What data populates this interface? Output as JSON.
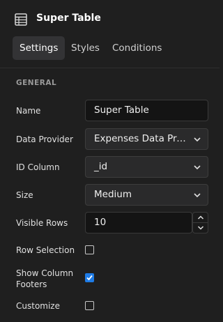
{
  "header": {
    "title": "Super Table",
    "icon": "table-icon"
  },
  "tabs": [
    {
      "label": "Settings",
      "active": true
    },
    {
      "label": "Styles",
      "active": false
    },
    {
      "label": "Conditions",
      "active": false
    }
  ],
  "section": {
    "label": "GENERAL"
  },
  "fields": {
    "name": {
      "label": "Name",
      "value": "Super Table"
    },
    "data_provider": {
      "label": "Data Provider",
      "value": "Expenses Data Provi..."
    },
    "id_column": {
      "label": "ID Column",
      "value": "_id"
    },
    "size": {
      "label": "Size",
      "value": "Medium"
    },
    "visible_rows": {
      "label": "Visible Rows",
      "value": "10"
    },
    "row_selection": {
      "label": "Row Selection",
      "checked": false
    },
    "show_column_footers": {
      "label_line1": "Show Column",
      "label_line2": "Footers",
      "checked": true
    },
    "customize": {
      "label": "Customize",
      "checked": false
    }
  },
  "colors": {
    "accent": "#1e7be6",
    "background": "#1f1f1f",
    "tab_active_bg": "#333335"
  }
}
